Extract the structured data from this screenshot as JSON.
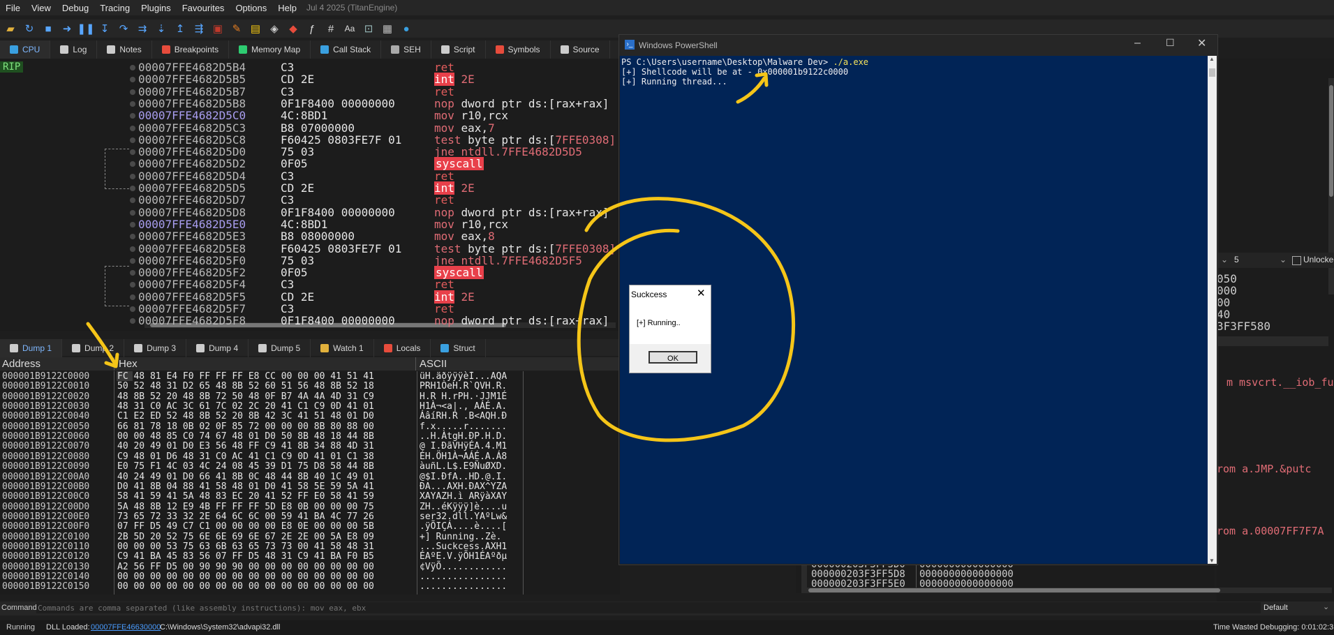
{
  "menu": [
    "File",
    "View",
    "Debug",
    "Tracing",
    "Plugins",
    "Favourites",
    "Options",
    "Help"
  ],
  "engine_label": "Jul 4 2025 (TitanEngine)",
  "toolbar_icons": [
    "open-icon",
    "restart-icon",
    "stop-icon",
    "run-icon",
    "pause-icon",
    "step-into-icon",
    "step-over-icon",
    "trace-into-icon",
    "trace-over-icon",
    "execute-till-return-icon",
    "run-to-user-code-icon",
    "highlight-icon",
    "patch-icon",
    "comment-icon",
    "label-icon",
    "bookmark-icon",
    "function-icon",
    "hash-icon",
    "font-icon",
    "lock-icon",
    "calculator-icon",
    "globe-icon"
  ],
  "tabs": [
    {
      "label": "CPU",
      "icon": "cpu-icon",
      "active": true
    },
    {
      "label": "Log",
      "icon": "log-icon"
    },
    {
      "label": "Notes",
      "icon": "notes-icon"
    },
    {
      "label": "Breakpoints",
      "icon": "breakpoint-icon"
    },
    {
      "label": "Memory Map",
      "icon": "memory-map-icon"
    },
    {
      "label": "Call Stack",
      "icon": "call-stack-icon"
    },
    {
      "label": "SEH",
      "icon": "seh-icon"
    },
    {
      "label": "Script",
      "icon": "script-icon"
    },
    {
      "label": "Symbols",
      "icon": "symbols-icon"
    },
    {
      "label": "Source",
      "icon": "source-icon"
    }
  ],
  "rip_label": "RIP",
  "disasm": [
    {
      "addr": "00007FFE4682D5B4",
      "bytes": "C3",
      "mn": "ret",
      "op": "",
      "type": "ret"
    },
    {
      "addr": "00007FFE4682D5B5",
      "bytes": "CD 2E",
      "mn": "int",
      "op": " 2E",
      "type": "int"
    },
    {
      "addr": "00007FFE4682D5B7",
      "bytes": "C3",
      "mn": "ret",
      "op": "",
      "type": "ret"
    },
    {
      "addr": "00007FFE4682D5B8",
      "bytes": "0F1F8400 00000000",
      "mn": "nop",
      "op": " dword ptr ds:[rax+rax]",
      "type": "nop"
    },
    {
      "addr": "00007FFE4682D5C0",
      "bytes": "4C:8BD1",
      "mn": "mov",
      "op": " r10,rcx",
      "type": "mov",
      "hl": true
    },
    {
      "addr": "00007FFE4682D5C3",
      "bytes": "B8 07000000",
      "mn": "mov",
      "op": " eax,",
      "imm": "7",
      "type": "mov"
    },
    {
      "addr": "00007FFE4682D5C8",
      "bytes": "F60425 0803FE7F 01",
      "mn": "test",
      "op": " byte ptr ds:[",
      "imm": "7FFE0308]",
      "type": "test"
    },
    {
      "addr": "00007FFE4682D5D0",
      "bytes": "75 03",
      "mn": "jne",
      "op": " ntdll.7FFE4682D5D5",
      "type": "jne"
    },
    {
      "addr": "00007FFE4682D5D2",
      "bytes": "0F05",
      "mn": "syscall",
      "op": "",
      "type": "syscall"
    },
    {
      "addr": "00007FFE4682D5D4",
      "bytes": "C3",
      "mn": "ret",
      "op": "",
      "type": "ret"
    },
    {
      "addr": "00007FFE4682D5D5",
      "bytes": "CD 2E",
      "mn": "int",
      "op": " 2E",
      "type": "int"
    },
    {
      "addr": "00007FFE4682D5D7",
      "bytes": "C3",
      "mn": "ret",
      "op": "",
      "type": "ret"
    },
    {
      "addr": "00007FFE4682D5D8",
      "bytes": "0F1F8400 00000000",
      "mn": "nop",
      "op": " dword ptr ds:[rax+rax]",
      "type": "nop"
    },
    {
      "addr": "00007FFE4682D5E0",
      "bytes": "4C:8BD1",
      "mn": "mov",
      "op": " r10,rcx",
      "type": "mov",
      "hl": true
    },
    {
      "addr": "00007FFE4682D5E3",
      "bytes": "B8 08000000",
      "mn": "mov",
      "op": " eax,",
      "imm": "8",
      "type": "mov"
    },
    {
      "addr": "00007FFE4682D5E8",
      "bytes": "F60425 0803FE7F 01",
      "mn": "test",
      "op": " byte ptr ds:[",
      "imm": "7FFE0308]",
      "type": "test"
    },
    {
      "addr": "00007FFE4682D5F0",
      "bytes": "75 03",
      "mn": "jne",
      "op": " ntdll.7FFE4682D5F5",
      "type": "jne"
    },
    {
      "addr": "00007FFE4682D5F2",
      "bytes": "0F05",
      "mn": "syscall",
      "op": "",
      "type": "syscall"
    },
    {
      "addr": "00007FFE4682D5F4",
      "bytes": "C3",
      "mn": "ret",
      "op": "",
      "type": "ret"
    },
    {
      "addr": "00007FFE4682D5F5",
      "bytes": "CD 2E",
      "mn": "int",
      "op": " 2E",
      "type": "int"
    },
    {
      "addr": "00007FFE4682D5F7",
      "bytes": "C3",
      "mn": "ret",
      "op": "",
      "type": "ret"
    },
    {
      "addr": "00007FFE4682D5F8",
      "bytes": "0F1F8400 00000000",
      "mn": "nop",
      "op": " dword ptr ds:[rax+rax]",
      "type": "nop"
    }
  ],
  "dump_tabs": [
    {
      "label": "Dump 1",
      "icon": "dump-icon",
      "active": true
    },
    {
      "label": "Dump 2",
      "icon": "dump-icon"
    },
    {
      "label": "Dump 3",
      "icon": "dump-icon"
    },
    {
      "label": "Dump 4",
      "icon": "dump-icon"
    },
    {
      "label": "Dump 5",
      "icon": "dump-icon"
    },
    {
      "label": "Watch 1",
      "icon": "watch-icon"
    },
    {
      "label": "Locals",
      "icon": "locals-icon"
    },
    {
      "label": "Struct",
      "icon": "struct-icon"
    }
  ],
  "dump_headers": {
    "address": "Address",
    "hex": "Hex",
    "ascii": "ASCII"
  },
  "dump_rows": [
    {
      "addr": "000001B9122C0000",
      "hex": "FC 48 81 E4 F0 FF FF FF E8 CC 00 00 00 41 51 41",
      "ascii": "üH.äðÿÿÿèÌ...AQA"
    },
    {
      "addr": "000001B9122C0010",
      "hex": "50 52 48 31 D2 65 48 8B 52 60 51 56 48 8B 52 18",
      "ascii": "PRH1ÒeH.R`QVH.R."
    },
    {
      "addr": "000001B9122C0020",
      "hex": "48 8B 52 20 48 8B 72 50 48 0F B7 4A 4A 4D 31 C9",
      "ascii": "H.R H.rPH.·JJM1É"
    },
    {
      "addr": "000001B9122C0030",
      "hex": "48 31 C0 AC 3C 61 7C 02 2C 20 41 C1 C9 0D 41 01",
      "ascii": "H1À¬<a|., AÁÉ.A."
    },
    {
      "addr": "000001B9122C0040",
      "hex": "C1 E2 ED 52 48 8B 52 20 8B 42 3C 41 51 48 01 D0",
      "ascii": "ÁâíRH.R .B<AQH.Ð"
    },
    {
      "addr": "000001B9122C0050",
      "hex": "66 81 78 18 0B 02 0F 85 72 00 00 00 8B 80 88 00",
      "ascii": "f.x.....r......."
    },
    {
      "addr": "000001B9122C0060",
      "hex": "00 00 48 85 C0 74 67 48 01 D0 50 8B 48 18 44 8B",
      "ascii": "..H.ÀtgH.ÐP.H.D."
    },
    {
      "addr": "000001B9122C0070",
      "hex": "40 20 49 01 D0 E3 56 48 FF C9 41 8B 34 88 4D 31",
      "ascii": "@ I.ÐãVHÿÉA.4.M1"
    },
    {
      "addr": "000001B9122C0080",
      "hex": "C9 48 01 D6 48 31 C0 AC 41 C1 C9 0D 41 01 C1 38",
      "ascii": "ÉH.ÖH1À¬AÁÉ.A.Á8"
    },
    {
      "addr": "000001B9122C0090",
      "hex": "E0 75 F1 4C 03 4C 24 08 45 39 D1 75 D8 58 44 8B",
      "ascii": "àuñL.L$.E9ÑuØXD."
    },
    {
      "addr": "000001B9122C00A0",
      "hex": "40 24 49 01 D0 66 41 8B 0C 48 44 8B 40 1C 49 01",
      "ascii": "@$I.ÐfA..HD.@.I."
    },
    {
      "addr": "000001B9122C00B0",
      "hex": "D0 41 8B 04 88 41 58 48 01 D0 41 58 5E 59 5A 41",
      "ascii": "ÐA...AXH.ÐAX^YZA"
    },
    {
      "addr": "000001B9122C00C0",
      "hex": "58 41 59 41 5A 48 83 EC 20 41 52 FF E0 58 41 59",
      "ascii": "XAYAZH.ì ARÿàXAY"
    },
    {
      "addr": "000001B9122C00D0",
      "hex": "5A 48 8B 12 E9 4B FF FF FF 5D E8 0B 00 00 00 75",
      "ascii": "ZH..éKÿÿÿ]è....u"
    },
    {
      "addr": "000001B9122C00E0",
      "hex": "73 65 72 33 32 2E 64 6C 6C 00 59 41 BA 4C 77 26",
      "ascii": "ser32.dll.YAºLw&"
    },
    {
      "addr": "000001B9122C00F0",
      "hex": "07 FF D5 49 C7 C1 00 00 00 00 E8 0E 00 00 00 5B",
      "ascii": ".ÿÕIÇÁ....è....["
    },
    {
      "addr": "000001B9122C0100",
      "hex": "2B 5D 20 52 75 6E 6E 69 6E 67 2E 2E 00 5A E8 09",
      "ascii": "+] Running..Zè."
    },
    {
      "addr": "000001B9122C0110",
      "hex": "00 00 00 53 75 63 6B 63 65 73 73 00 41 58 48 31",
      "ascii": "...Suckcess.AXH1"
    },
    {
      "addr": "000001B9122C0120",
      "hex": "C9 41 BA 45 83 56 07 FF D5 48 31 C9 41 BA F0 B5",
      "ascii": "ÉAºE.V.ÿÕH1ÉAºðµ"
    },
    {
      "addr": "000001B9122C0130",
      "hex": "A2 56 FF D5 00 90 90 90 00 00 00 00 00 00 00 00",
      "ascii": "¢VÿÕ............"
    },
    {
      "addr": "000001B9122C0140",
      "hex": "00 00 00 00 00 00 00 00 00 00 00 00 00 00 00 00",
      "ascii": "................"
    },
    {
      "addr": "000001B9122C0150",
      "hex": "00 00 00 00 00 00 00 00 00 00 00 00 00 00 00 00",
      "ascii": "................"
    }
  ],
  "command": {
    "label": "Command:",
    "placeholder": "Commands are comma separated (like assembly instructions): mov eax, ebx",
    "dropdown": "Default"
  },
  "status": {
    "state": "Running",
    "dll_prefix": "DLL Loaded:",
    "dll_addr": "00007FFE46630000",
    "dll_path": "C:\\Windows\\System32\\advapi32.dll",
    "time": "Time Wasted Debugging: 0:01:02:3"
  },
  "powershell": {
    "title": "Windows PowerShell",
    "prompt": "PS C:\\Users\\username\\Desktop\\Malware Dev>",
    "command": " ./a.exe",
    "lines": [
      "[+] Shellcode will be at - 0x000001b9122c0000",
      "[+] Running thread..."
    ]
  },
  "dialog": {
    "title": "Suckcess",
    "message": "[+] Running..",
    "ok": "OK"
  },
  "right_pane": {
    "combo_value": "5",
    "unlocked": "Unlocked",
    "reg_values": [
      "050",
      "000",
      "00",
      "40",
      "3F3FF580"
    ],
    "comments": [
      "m msvcrt.__iob_fu",
      "rom a.JMP.&putc",
      "rom a.00007FF7F7A"
    ],
    "stack_rows": [
      {
        "addr": "000000203F3FF5D0",
        "val": "0000000000000000"
      },
      {
        "addr": "000000203F3FF5D8",
        "val": "0000000000000000"
      },
      {
        "addr": "000000203F3FF5E0",
        "val": "0000000000000000"
      }
    ]
  },
  "colors": {
    "accent": "#4a9cff",
    "annotation": "#f5c518",
    "ps_bg": "#012456",
    "syscall_bg": "#e8404a"
  }
}
